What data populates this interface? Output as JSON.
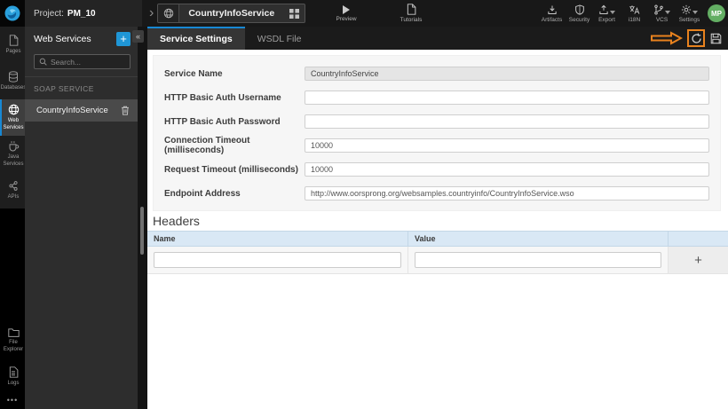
{
  "colors": {
    "accent_blue": "#1788d4",
    "add_button_blue": "#1f96d6",
    "annotation_orange": "#e8821e",
    "avatar_green": "#63ae63",
    "logo_blue": "#2aa0dc"
  },
  "topbar": {
    "project_prefix": "Project:",
    "project_name": "PM_10",
    "service_name": "CountryInfoService",
    "preview_label": "Preview",
    "tutorials_label": "Tutorials",
    "actions": {
      "artifacts": "Artifacts",
      "security": "Security",
      "export": "Export",
      "i18n": "i18N",
      "vcs": "VCS",
      "settings": "Settings"
    },
    "avatar_initials": "MP"
  },
  "rail": {
    "items": [
      {
        "label": "Pages"
      },
      {
        "label": "Databases"
      },
      {
        "label": "Web Services",
        "active": true
      },
      {
        "label": "Java Services"
      },
      {
        "label": "APIs"
      }
    ],
    "bottom_items": [
      {
        "label": "File Explorer"
      },
      {
        "label": "Logs"
      }
    ],
    "more_glyph": "•••"
  },
  "sidebar": {
    "title": "Web Services",
    "add_glyph": "+",
    "collapse_glyph": "«",
    "search_placeholder": "Search...",
    "section_label": "SOAP SERVICE",
    "items": [
      {
        "name": "CountryInfoService"
      }
    ]
  },
  "tabs": {
    "service_settings": "Service Settings",
    "wsdl_file": "WSDL File"
  },
  "form": {
    "fields": [
      {
        "label": "Service Name",
        "value": "CountryInfoService"
      },
      {
        "label": "HTTP Basic Auth Username",
        "value": ""
      },
      {
        "label": "HTTP Basic Auth Password",
        "value": ""
      },
      {
        "label": "Connection Timeout (milliseconds)",
        "value": "10000"
      },
      {
        "label": "Request Timeout (milliseconds)",
        "value": "10000"
      },
      {
        "label": "Endpoint Address",
        "value": "http://www.oorsprong.org/websamples.countryinfo/CountryInfoService.wso"
      }
    ]
  },
  "headers_section": {
    "title": "Headers",
    "name_column": "Name",
    "value_column": "Value",
    "add_glyph": "+"
  },
  "chevron_glyph": "›"
}
